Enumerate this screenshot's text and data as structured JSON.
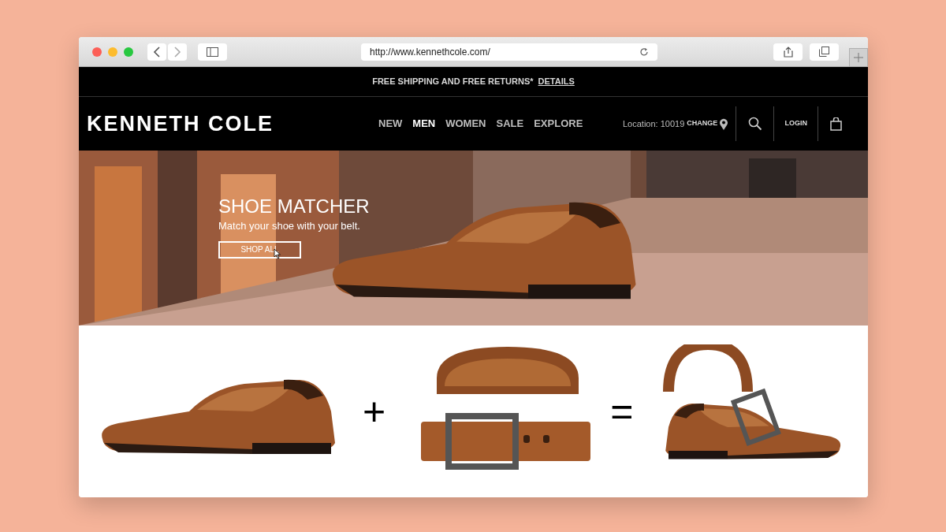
{
  "browser": {
    "url": "http://www.kennethcole.com/"
  },
  "promo_bar": {
    "text": "FREE SHIPPING AND FREE RETURNS*",
    "link": "DETAILS"
  },
  "header": {
    "logo": "KENNETH COLE",
    "nav": [
      {
        "label": "NEW",
        "selected": false
      },
      {
        "label": "MEN",
        "selected": true
      },
      {
        "label": "WOMEN",
        "selected": false
      },
      {
        "label": "SALE",
        "selected": false
      },
      {
        "label": "EXPLORE",
        "selected": false
      }
    ],
    "location": "Location: 10019",
    "location_action": "CHANGE",
    "login": "LOGIN"
  },
  "hero": {
    "title": "SHOE MATCHER",
    "subtitle": "Match your shoe with your belt.",
    "button": "SHOP ALL"
  },
  "equation": {
    "plus": "+",
    "equals": "="
  }
}
